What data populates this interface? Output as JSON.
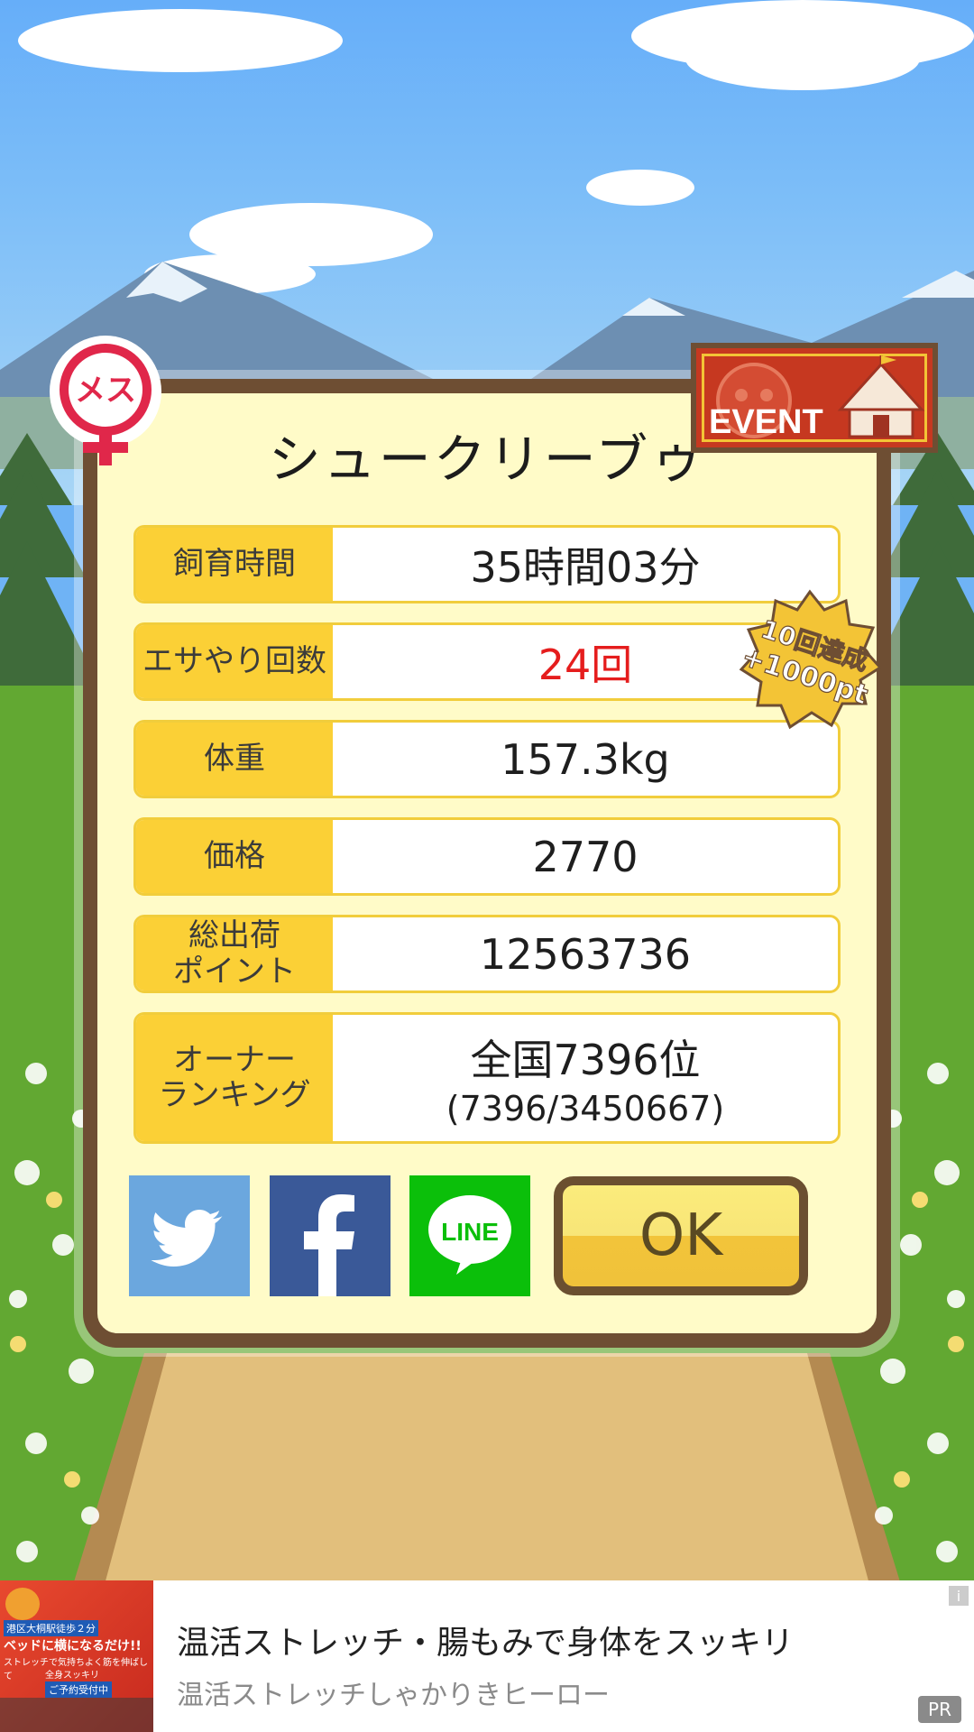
{
  "character": {
    "name": "シュークリーブゥ",
    "gender_badge": "メス"
  },
  "event_badge": {
    "label": "EVENT"
  },
  "bonus_badge": {
    "line1": "10回達成",
    "line2": "+1000pt"
  },
  "stats": [
    {
      "label": "飼育時間",
      "value": "35時間03分"
    },
    {
      "label": "エサやり回数",
      "value": "24回",
      "color": "#e51d1d"
    },
    {
      "label": "体重",
      "value": "157.3kg"
    },
    {
      "label": "価格",
      "value": "2770"
    },
    {
      "label": "総出荷\nポイント",
      "value": "12563736"
    },
    {
      "label": "オーナー\nランキング",
      "value": "全国7396位",
      "sub": "(7396/3450667)"
    }
  ],
  "share": {
    "twitter": "twitter-icon",
    "facebook": "facebook-icon",
    "line_label": "LINE"
  },
  "ok_button": {
    "label": "OK"
  },
  "ad": {
    "title": "温活ストレッチ・腸もみで身体をスッキリ",
    "subtitle": "温活ストレッチしゃかりきヒーロー",
    "pr_label": "PR",
    "info_label": "i",
    "thumb_text_1": "港区大桐駅徒歩２分",
    "thumb_text_2": "ベッドに横になるだけ!!",
    "thumb_text_3": "ストレッチで気持ちよく筋を伸ばして",
    "thumb_text_4": "全身スッキリ",
    "thumb_text_5": "ご予約受付中"
  },
  "colors": {
    "label_bg": "#fbd036",
    "dialog_bg": "#fffbc8",
    "frame": "#6e4e33"
  }
}
